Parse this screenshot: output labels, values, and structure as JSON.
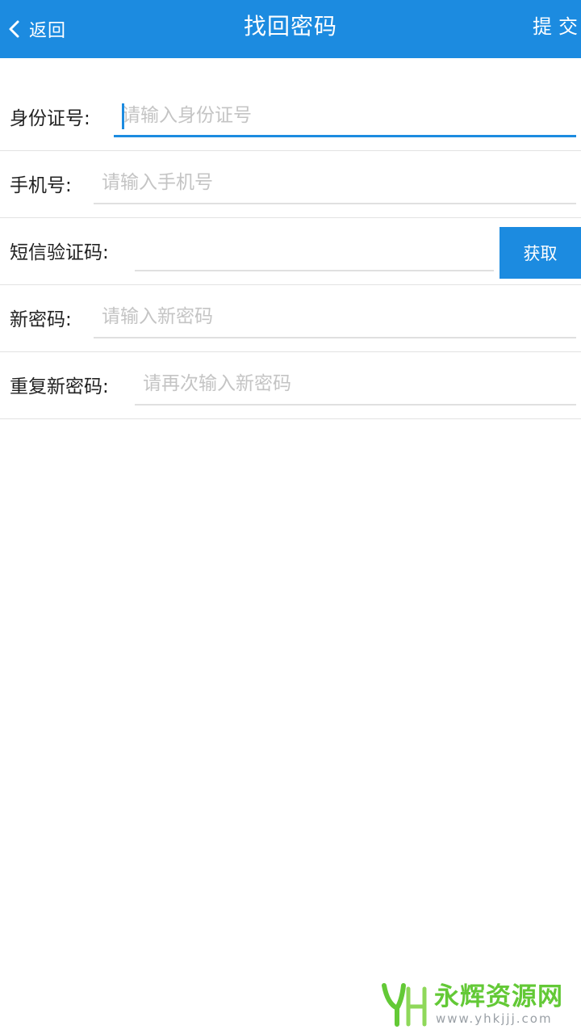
{
  "header": {
    "back_label": "返回",
    "title": "找回密码",
    "submit_label": "提交"
  },
  "form": {
    "id_card": {
      "label": "身份证号:",
      "placeholder": "请输入身份证号",
      "value": ""
    },
    "phone": {
      "label": "手机号:",
      "placeholder": "请输入手机号",
      "value": ""
    },
    "sms_code": {
      "label": "短信验证码:",
      "placeholder": "",
      "value": "",
      "get_button": "获取"
    },
    "new_password": {
      "label": "新密码:",
      "placeholder": "请输入新密码",
      "value": ""
    },
    "repeat_password": {
      "label": "重复新密码:",
      "placeholder": "请再次输入新密码",
      "value": ""
    }
  },
  "watermark": {
    "name": "永辉资源网",
    "url": "www.yhkjjj.com"
  },
  "colors": {
    "accent": "#1c8be0",
    "watermark_green": "#63c936"
  },
  "icons": {
    "back": "chevron-left-icon",
    "watermark_logo": "yh-logo-icon"
  }
}
